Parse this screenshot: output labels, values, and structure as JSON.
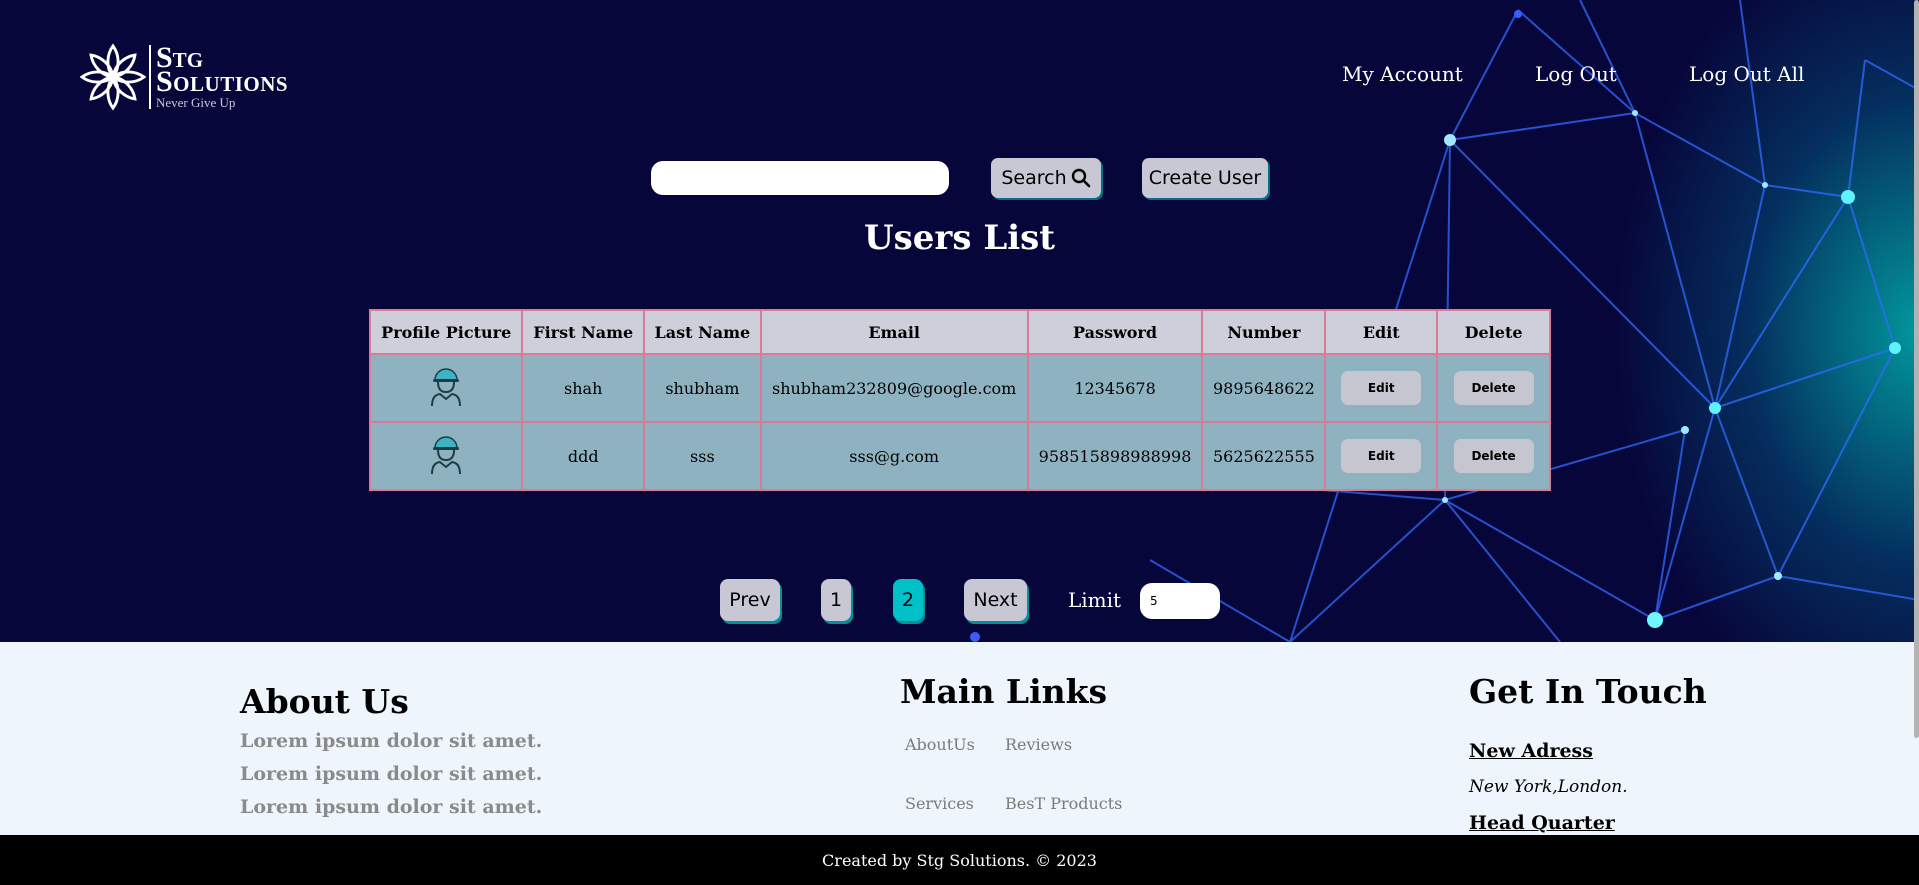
{
  "logo": {
    "line1": "Stg",
    "line2": "Solutions",
    "tagline": "Never Give Up"
  },
  "nav": {
    "my_account": "My Account",
    "log_out": "Log Out",
    "log_out_all": "Log Out All"
  },
  "toolbar": {
    "search_value": "",
    "search_label": "Search",
    "create_label": "Create User"
  },
  "page_title": "Users List",
  "table": {
    "headers": [
      "Profile Picture",
      "First Name",
      "Last Name",
      "Email",
      "Password",
      "Number",
      "Edit",
      "Delete"
    ],
    "rows": [
      {
        "first": "shah",
        "last": "shubham",
        "email": "shubham232809@google.com",
        "password": "12345678",
        "number": "9895648622",
        "edit": "Edit",
        "delete": "Delete"
      },
      {
        "first": "ddd",
        "last": "sss",
        "email": "sss@g.com",
        "password": "958515898988998",
        "number": "5625622555",
        "edit": "Edit",
        "delete": "Delete"
      }
    ]
  },
  "pagination": {
    "prev": "Prev",
    "page1": "1",
    "page2": "2",
    "next": "Next",
    "limit_label": "Limit",
    "limit_value": "5",
    "current_page": 2
  },
  "footer": {
    "about_title": "About Us",
    "about_lines": [
      "Lorem ipsum dolor sit amet.",
      "Lorem ipsum dolor sit amet.",
      "Lorem ipsum dolor sit amet."
    ],
    "links_title": "Main Links",
    "links": [
      "AboutUs",
      "Reviews",
      "Services",
      "BesT Products"
    ],
    "contact_title": "Get In Touch",
    "new_address_label": "New Adress",
    "new_address_value": "New York,London.",
    "hq_label": "Head Quarter",
    "copyright": "Created by Stg Solutions. © 2023"
  },
  "colors": {
    "hero_bg": "#07063a",
    "accent": "#00c0c8",
    "table_row": "#8fb2c1",
    "table_head": "#cfcfdb",
    "border": "#d87a98"
  },
  "icons": [
    "flower-logo-icon",
    "search-icon",
    "worker-avatar-icon"
  ]
}
